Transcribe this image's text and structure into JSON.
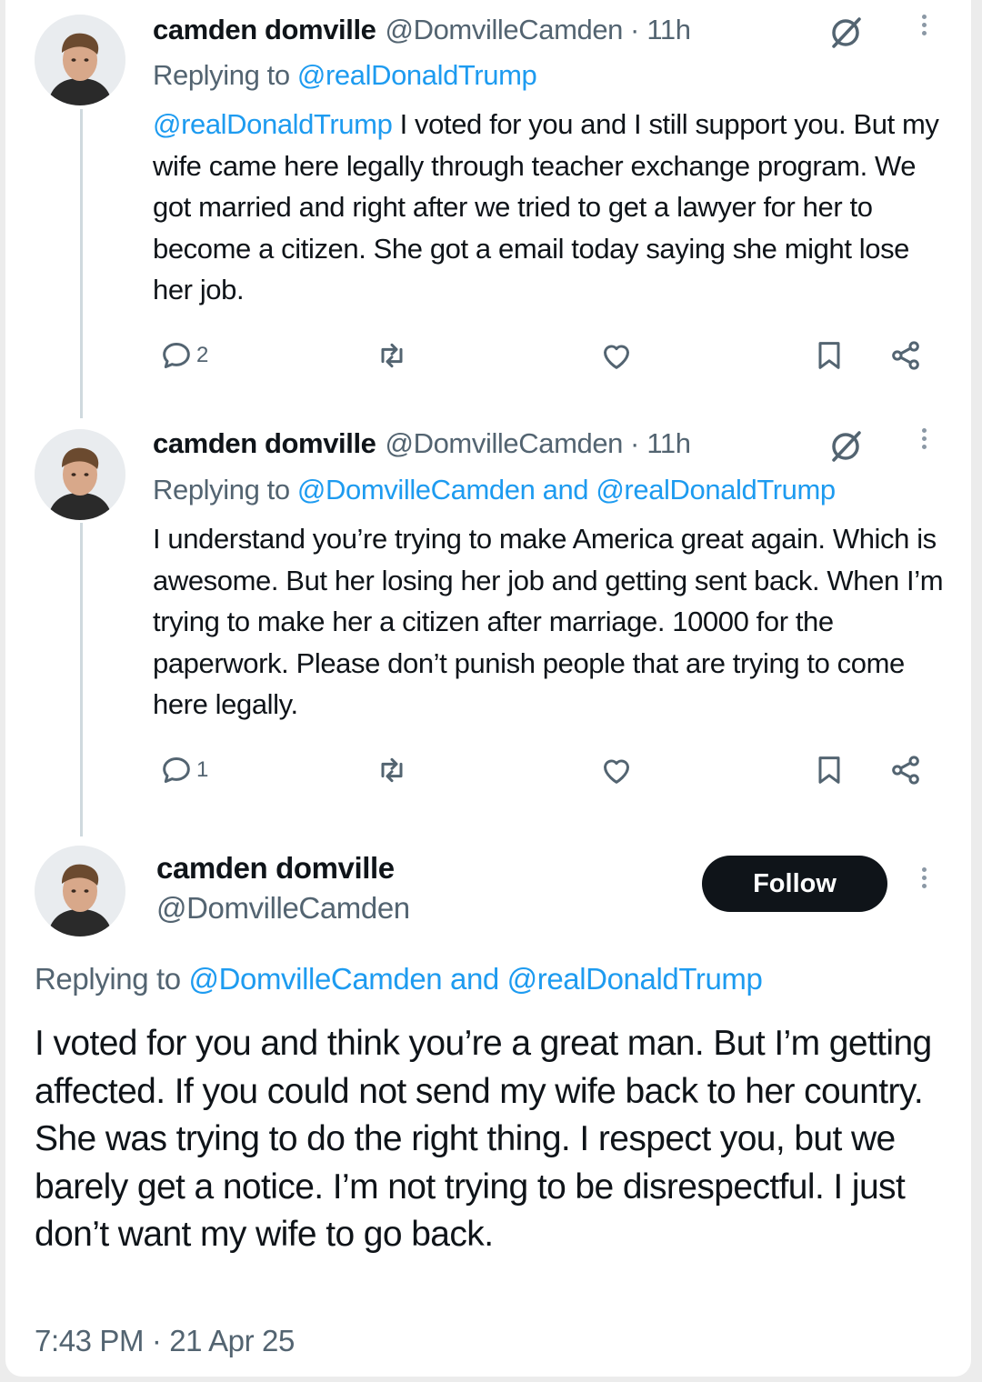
{
  "tweets": [
    {
      "name": "camden domville",
      "handle": "@DomvilleCamden",
      "time": "11h",
      "replying_prefix": "Replying to",
      "replying_mentions": "@realDonaldTrump",
      "body_mention": "@realDonaldTrump",
      "body_text": " I voted for you and I still support you. But my wife came here legally through teacher exchange program. We got married and right after we tried to get a lawyer for her to become a citizen. She got a email today saying she might lose her job.",
      "reply_count": "2"
    },
    {
      "name": "camden domville",
      "handle": "@DomvilleCamden",
      "time": "11h",
      "replying_prefix": "Replying to",
      "replying_mentions": "@DomvilleCamden and @realDonaldTrump",
      "body_text": "I understand you’re trying to make America great again. Which is awesome. But her losing her job and getting sent back. When I’m trying to make her a citizen after marriage. 10000 for the paperwork. Please don’t punish people that are trying to come here legally.",
      "reply_count": "1"
    }
  ],
  "main": {
    "name": "camden domville",
    "handle": "@DomvilleCamden",
    "follow_label": "Follow",
    "replying_prefix": "Replying to",
    "replying_mentions": "@DomvilleCamden and @realDonaldTrump",
    "body_text": "I voted for you and think you’re a great man. But I’m getting affected. If you could not send my wife back to her country. She was trying to do the right thing. I respect you, but we barely get a notice. I’m not trying to be disrespectful. I just don’t want my wife to go back.",
    "timestamp": "7:43 PM · 21 Apr 25"
  },
  "separator": "·",
  "colors": {
    "text": "#0f1419",
    "secondary": "#536471",
    "link": "#1d9bf0",
    "thread_line": "#cfd9de",
    "follow_button": "#0f1419"
  },
  "icons": {
    "reply": "reply-icon",
    "repost": "repost-icon",
    "like": "heart-icon",
    "bookmark": "bookmark-icon",
    "share": "share-icon",
    "grok": "grok-icon",
    "more": "more-icon"
  }
}
